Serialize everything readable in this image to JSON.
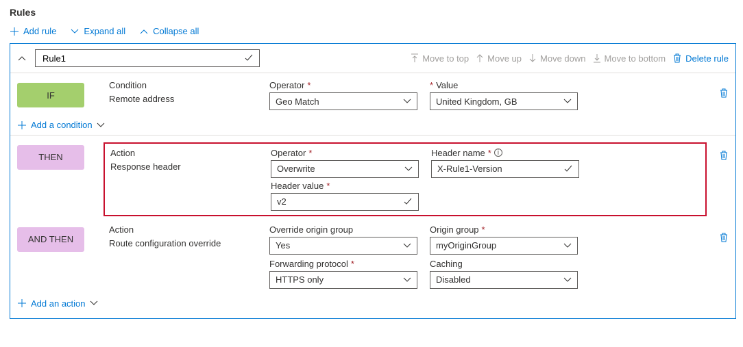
{
  "section_title": "Rules",
  "toolbar": {
    "add_rule": "Add rule",
    "expand_all": "Expand all",
    "collapse_all": "Collapse all"
  },
  "rule": {
    "name": "Rule1",
    "move_top": "Move to top",
    "move_up": "Move up",
    "move_down": "Move down",
    "move_bottom": "Move to bottom",
    "delete": "Delete rule"
  },
  "badges": {
    "if": "IF",
    "then": "THEN",
    "andthen": "AND THEN"
  },
  "condition": {
    "label": "Condition",
    "value": "Remote address",
    "operator_label": "Operator",
    "operator_value": "Geo Match",
    "val_label": "Value",
    "val_value": "United Kingdom, GB"
  },
  "add_condition": "Add a condition",
  "action1": {
    "label": "Action",
    "value": "Response header",
    "operator_label": "Operator",
    "operator_value": "Overwrite",
    "header_name_label": "Header name",
    "header_name_value": "X-Rule1-Version",
    "header_value_label": "Header value",
    "header_value_value": "v2"
  },
  "action2": {
    "label": "Action",
    "value": "Route configuration override",
    "override_label": "Override origin group",
    "override_value": "Yes",
    "origin_group_label": "Origin group",
    "origin_group_value": "myOriginGroup",
    "protocol_label": "Forwarding protocol",
    "protocol_value": "HTTPS only",
    "caching_label": "Caching",
    "caching_value": "Disabled"
  },
  "add_action": "Add an action"
}
